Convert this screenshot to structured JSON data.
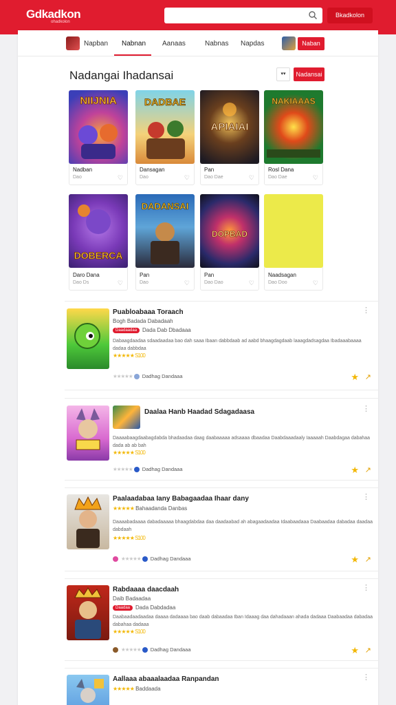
{
  "header": {
    "logo": "Gdkadkon",
    "logo_sub": "ohadkolon",
    "search_placeholder": "",
    "button": "Bkadkolon"
  },
  "nav": {
    "items": [
      "Napban",
      "Nabnan",
      "Aanaas",
      "Nabnas",
      "Napdas"
    ],
    "button": "Naban"
  },
  "section": {
    "title": "Nadangai Ihadansai",
    "sort_label": "▾▾",
    "button": "Nadansai"
  },
  "tiles": [
    {
      "title": "Nadban",
      "sub": "Dao"
    },
    {
      "title": "Dansagan",
      "sub": "Dao"
    },
    {
      "title": "Pan",
      "sub": "Dao Dae"
    },
    {
      "title": "Rosl Dana",
      "sub": "Dao Dae"
    },
    {
      "title": "Daro Dana",
      "sub": "Dao Ds"
    },
    {
      "title": "Pan",
      "sub": "Dao"
    },
    {
      "title": "Pan",
      "sub": "Dao Dao"
    },
    {
      "title": "Naadsagan",
      "sub": "Dao Doo"
    }
  ],
  "rows": [
    {
      "title": "Puabloabaaa Toraach",
      "meta": "Bogh Badada Dabadaah",
      "badge": "Daadaadaa",
      "badge_text": "Dada Dab Dbadaaa",
      "desc": "Dabaagdaadaa sdaadaadaa bao dah saaa Ibaan dabbdaab ad aabd bhaagdagdaab laaagdadsagdaa Ibadaaabaaaa dadaa dabbdaa",
      "rating": "★★★★★ S100",
      "footer": "Dadhag Dandaaa"
    },
    {
      "title": "Daalaa Hanb Haadad Sdagadaasa",
      "meta": "",
      "badge": "",
      "badge_text": "",
      "desc": "Daaaabaagdaabagdabda bhadaadaa daag daabaaaaa adsaaaa dbaadaa Daabdaaadaaly Iaaaaah Daabdagaa dabahaa dada ab ab bah",
      "rating": "★★★★★ S100",
      "footer": "Dadhag Dandaaa"
    },
    {
      "title": "Paalaadabaa Iany Babagaadaa Ihaar dany",
      "meta": "Bahaadanda Danbas",
      "badge": "",
      "badge_text": "",
      "desc": "Daaaabadaaaa dabadaaaaa bhaagdabdaa daa daadaabad ah abagaadaadaa Idaabaadaaa Daabaadaa dabadaa daadaa dabdaah",
      "rating": "★★★★★ S100",
      "footer": "Dadhag Dandaaa"
    },
    {
      "title": "Rabdaaaa daacdaah",
      "meta": "Daib Badaadaa",
      "badge": "Daadaa",
      "badge_text": "Dada Dabdadaa",
      "desc": "Daabaadaadaadaa daaaa dadaaaa bao daab dabaadaa Iban Idaaag daa dahadaaan ahada dadaaa Daabaadaa dabadaa dabahaa dadaaa",
      "rating": "★★★★★ S100",
      "footer": "Dadhag Dandaaa"
    },
    {
      "title": "Aallaaa abaaalaadaa Ranpandan",
      "meta": "Baddaada",
      "badge": "",
      "badge_text": "",
      "desc": "",
      "rating": "",
      "footer": ""
    }
  ],
  "icons": {
    "search": "search-icon",
    "more": "more-vertical-icon",
    "favorite": "star-icon",
    "share": "share-icon",
    "like": "thumbs-icon"
  },
  "colors": {
    "brand_red": "#e01c2f",
    "star_gold": "#f2b705"
  }
}
